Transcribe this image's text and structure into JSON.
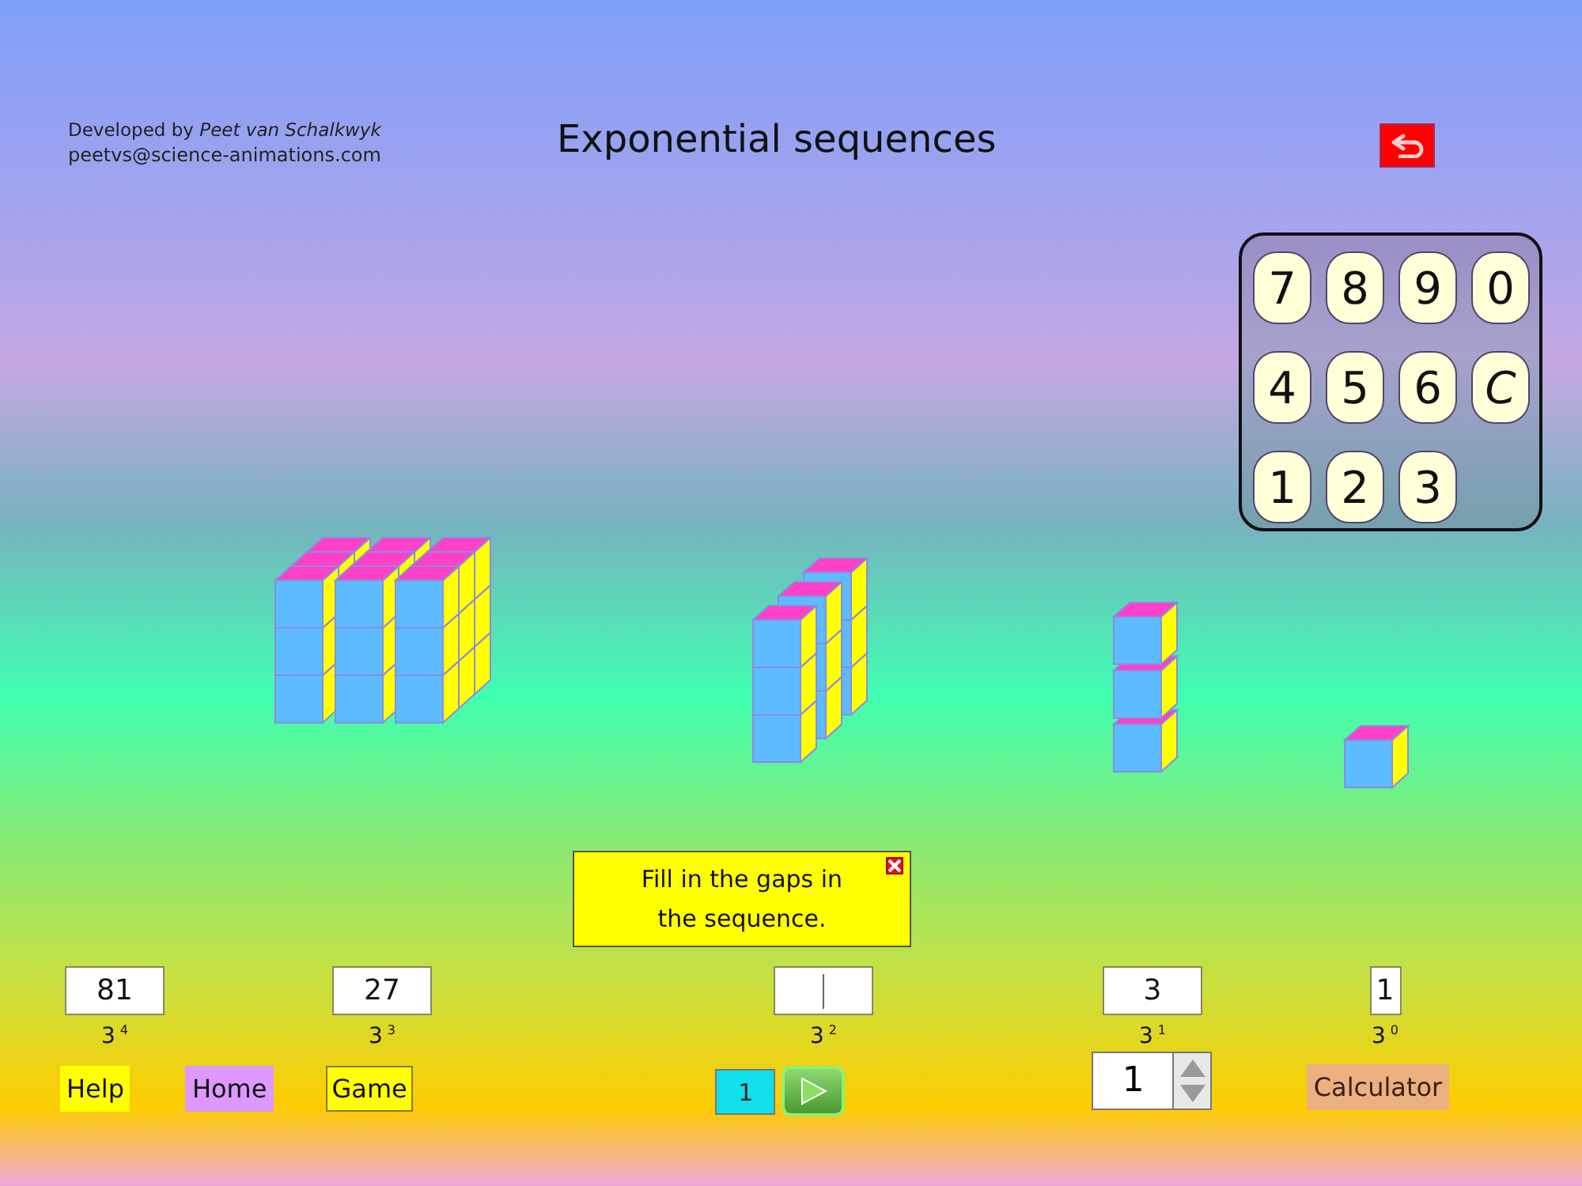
{
  "credit": {
    "line": "Developed by *Peet van Schalkwyk*",
    "email": "peetvs@science-animations.com"
  },
  "title": "Exponential sequences",
  "keypad": {
    "keys": [
      {
        "label": "7",
        "kind": "digit"
      },
      {
        "label": "8",
        "kind": "digit"
      },
      {
        "label": "9",
        "kind": "digit"
      },
      {
        "label": "0",
        "kind": "digit"
      },
      {
        "label": "4",
        "kind": "digit"
      },
      {
        "label": "5",
        "kind": "digit"
      },
      {
        "label": "6",
        "kind": "digit"
      },
      {
        "label": "C",
        "kind": "clear"
      },
      {
        "label": "1",
        "kind": "digit"
      },
      {
        "label": "2",
        "kind": "digit"
      },
      {
        "label": "3",
        "kind": "digit"
      }
    ]
  },
  "hint": {
    "text": "Fill in the gaps in the sequence."
  },
  "sequence": [
    {
      "kind": "given",
      "value": "81",
      "power": "3$^{4}$"
    },
    {
      "kind": "given",
      "value": "27",
      "power": "3$^{3}$"
    },
    {
      "kind": "blank",
      "focused": true,
      "power": "3$^{2}$"
    },
    {
      "kind": "given",
      "value": "3",
      "power": "3$^{1}$"
    },
    {
      "kind": "given",
      "value": "1",
      "power": "3$^{0}$"
    }
  ],
  "nav_buttons": [
    {
      "label": "Help",
      "color": "#ffff00",
      "selected": false
    },
    {
      "label": "Home",
      "color": "#dd99ff",
      "selected": false
    },
    {
      "label": "Game",
      "color": "#ffff00",
      "selected": true
    }
  ],
  "step": {
    "value": "1"
  },
  "spinner": {
    "value": "1"
  },
  "calculator_button": {
    "label": "Calculator",
    "color": "#ebb080"
  }
}
